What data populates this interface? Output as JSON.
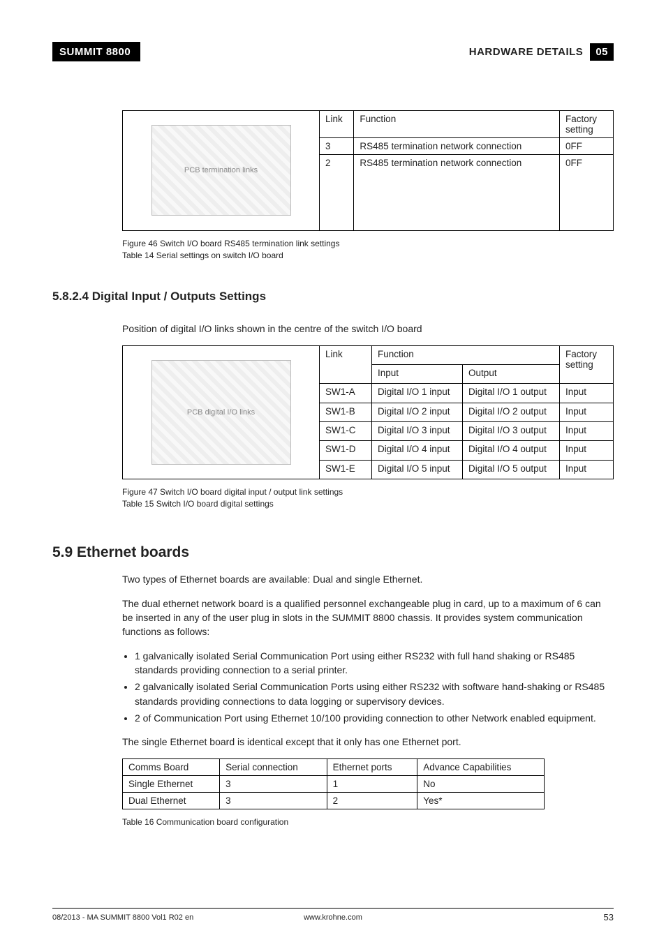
{
  "header": {
    "left": "SUMMIT 8800",
    "right_text": "HARDWARE DETAILS",
    "right_num": "05"
  },
  "table1": {
    "head": {
      "link": "Link",
      "function": "Function",
      "factory": "Factory setting"
    },
    "rows": [
      {
        "link": "3",
        "function": "RS485 termination network connection",
        "factory": "0FF"
      },
      {
        "link": "2",
        "function": "RS485 termination network connection",
        "factory": "0FF"
      }
    ],
    "image_alt": "PCB termination links"
  },
  "caption1a": "Figure 46    Switch I/O board RS485 termination link settings",
  "caption1b": "Table 14  Serial settings on switch I/O board",
  "sec5824": {
    "heading": "5.8.2.4 Digital Input / Outputs Settings",
    "intro": "Position of digital I/O links shown in the centre of the switch I/O board"
  },
  "table2": {
    "head": {
      "link": "Link",
      "function": "Function",
      "input": "Input",
      "output": "Output",
      "factory": "Factory setting"
    },
    "rows": [
      {
        "link": "SW1-A",
        "input": "Digital I/O 1 input",
        "output": "Digital I/O 1 output",
        "factory": "Input"
      },
      {
        "link": "SW1-B",
        "input": "Digital I/O 2 input",
        "output": "Digital I/O 2 output",
        "factory": "Input"
      },
      {
        "link": "SW1-C",
        "input": "Digital I/O 3 input",
        "output": "Digital I/O 3 output",
        "factory": "Input"
      },
      {
        "link": "SW1-D",
        "input": "Digital I/O 4 input",
        "output": "Digital I/O 4 output",
        "factory": "Input"
      },
      {
        "link": "SW1-E",
        "input": "Digital I/O 5 input",
        "output": "Digital I/O 5 output",
        "factory": "Input"
      }
    ],
    "image_alt": "PCB digital I/O links"
  },
  "caption2a": "Figure 47    Switch I/O board digital input / output link settings",
  "caption2b": "Table 15  Switch I/O board digital settings",
  "sec59": {
    "heading": "5.9 Ethernet boards",
    "p1": "Two types of Ethernet boards are available: Dual and single Ethernet.",
    "p2": "The dual ethernet network board is a qualified personnel exchangeable plug in card, up to a maximum of 6 can be inserted in any of the user plug in slots in the SUMMIT 8800 chassis. It provides system communication functions as follows:",
    "b1": "  1 galvanically isolated Serial Communication Port using either RS232 with full hand shaking or RS485 standards providing connection to a serial printer.",
    "b2": "  2 galvanically isolated Serial Communication Ports using either RS232 with software hand-shaking or RS485 standards providing connections to data logging or supervisory devices.",
    "b3": "  2 of Communication Port using Ethernet 10/100 providing connection to other Network enabled equipment.",
    "p3": "The single Ethernet board is identical except that it only has one Ethernet port."
  },
  "table3": {
    "head": {
      "c1": "Comms Board",
      "c2": "Serial connection",
      "c3": "Ethernet ports",
      "c4": "Advance Capabilities"
    },
    "rows": [
      {
        "c1": "Single Ethernet",
        "c2": "3",
        "c3": "1",
        "c4": "No"
      },
      {
        "c1": "Dual Ethernet",
        "c2": "3",
        "c3": "2",
        "c4": "Yes*"
      }
    ]
  },
  "caption3": "Table 16  Communication board configuration",
  "footer": {
    "left": "08/2013 - MA SUMMIT 8800 Vol1 R02 en",
    "center": "www.krohne.com",
    "right": "53"
  }
}
